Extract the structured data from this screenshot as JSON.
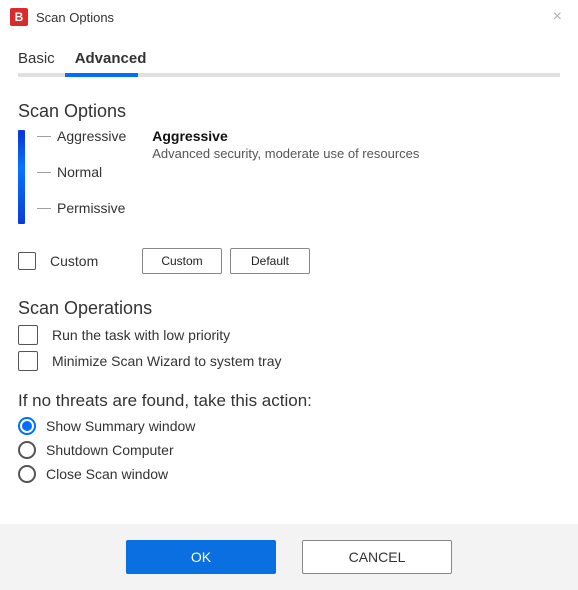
{
  "window": {
    "title": "Scan Options"
  },
  "tabs": {
    "basic": "Basic",
    "advanced": "Advanced",
    "activeIndex": 1
  },
  "scanOptions": {
    "heading": "Scan Options",
    "levels": [
      "Aggressive",
      "Normal",
      "Permissive"
    ],
    "selected": {
      "title": "Aggressive",
      "desc": "Advanced security, moderate use of resources"
    },
    "custom": {
      "label": "Custom",
      "checked": false
    },
    "buttons": {
      "custom": "Custom",
      "default": "Default"
    }
  },
  "scanOperations": {
    "heading": "Scan Operations",
    "items": [
      {
        "label": "Run the task with low priority",
        "checked": false
      },
      {
        "label": "Minimize Scan Wizard to system tray",
        "checked": false
      }
    ]
  },
  "noThreats": {
    "heading": "If no threats are found, take this action:",
    "options": [
      {
        "label": "Show Summary window",
        "selected": true
      },
      {
        "label": "Shutdown Computer",
        "selected": false
      },
      {
        "label": "Close Scan window",
        "selected": false
      }
    ]
  },
  "footer": {
    "ok": "OK",
    "cancel": "CANCEL"
  },
  "colors": {
    "accent": "#0a6fe0",
    "slider": "#0a3bd8"
  }
}
